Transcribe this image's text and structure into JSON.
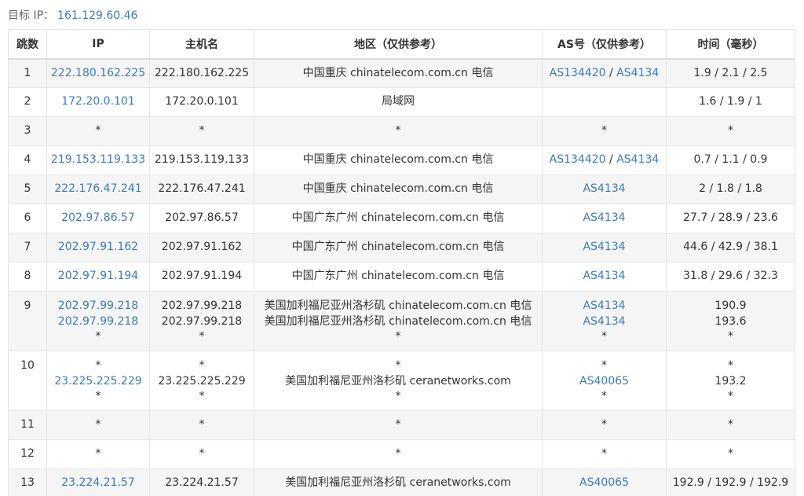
{
  "header": {
    "label": "目标 IP：",
    "ip": "161.129.60.46"
  },
  "columns": [
    "跳数",
    "IP",
    "主机名",
    "地区（仅供参考）",
    "AS号（仅供参考）",
    "时间（毫秒）"
  ],
  "rows": [
    {
      "hop": "1",
      "ip": [
        "222.180.162.225"
      ],
      "host": [
        "222.180.162.225"
      ],
      "region": [
        "中国重庆 chinatelecom.com.cn 电信"
      ],
      "as": [
        [
          "AS134420",
          "AS4134"
        ]
      ],
      "time": [
        "1.9 / 2.1 / 2.5"
      ]
    },
    {
      "hop": "2",
      "ip": [
        "172.20.0.101"
      ],
      "host": [
        "172.20.0.101"
      ],
      "region": [
        "局域网"
      ],
      "as": [
        []
      ],
      "time": [
        "1.6 / 1.9 / 1"
      ]
    },
    {
      "hop": "3",
      "ip": [
        "*"
      ],
      "host": [
        "*"
      ],
      "region": [
        "*"
      ],
      "as": [
        [
          "*"
        ]
      ],
      "time": [
        "*"
      ]
    },
    {
      "hop": "4",
      "ip": [
        "219.153.119.133"
      ],
      "host": [
        "219.153.119.133"
      ],
      "region": [
        "中国重庆 chinatelecom.com.cn 电信"
      ],
      "as": [
        [
          "AS134420",
          "AS4134"
        ]
      ],
      "time": [
        "0.7 / 1.1 / 0.9"
      ]
    },
    {
      "hop": "5",
      "ip": [
        "222.176.47.241"
      ],
      "host": [
        "222.176.47.241"
      ],
      "region": [
        "中国重庆 chinatelecom.com.cn 电信"
      ],
      "as": [
        [
          "AS4134"
        ]
      ],
      "time": [
        "2 / 1.8 / 1.8"
      ]
    },
    {
      "hop": "6",
      "ip": [
        "202.97.86.57"
      ],
      "host": [
        "202.97.86.57"
      ],
      "region": [
        "中国广东广州 chinatelecom.com.cn 电信"
      ],
      "as": [
        [
          "AS4134"
        ]
      ],
      "time": [
        "27.7 / 28.9 / 23.6"
      ]
    },
    {
      "hop": "7",
      "ip": [
        "202.97.91.162"
      ],
      "host": [
        "202.97.91.162"
      ],
      "region": [
        "中国广东广州 chinatelecom.com.cn 电信"
      ],
      "as": [
        [
          "AS4134"
        ]
      ],
      "time": [
        "44.6 / 42.9 / 38.1"
      ]
    },
    {
      "hop": "8",
      "ip": [
        "202.97.91.194"
      ],
      "host": [
        "202.97.91.194"
      ],
      "region": [
        "中国广东广州 chinatelecom.com.cn 电信"
      ],
      "as": [
        [
          "AS4134"
        ]
      ],
      "time": [
        "31.8 / 29.6 / 32.3"
      ]
    },
    {
      "hop": "9",
      "ip": [
        "202.97.99.218",
        "202.97.99.218",
        "*"
      ],
      "host": [
        "202.97.99.218",
        "202.97.99.218",
        "*"
      ],
      "region": [
        "美国加利福尼亚州洛杉矶 chinatelecom.com.cn 电信",
        "美国加利福尼亚州洛杉矶 chinatelecom.com.cn 电信",
        "*"
      ],
      "as": [
        [
          "AS4134"
        ],
        [
          "AS4134"
        ],
        [
          "*"
        ]
      ],
      "time": [
        "190.9",
        "193.6",
        "*"
      ]
    },
    {
      "hop": "10",
      "ip": [
        "*",
        "23.225.225.229",
        "*"
      ],
      "host": [
        "*",
        "23.225.225.229",
        "*"
      ],
      "region": [
        "*",
        "美国加利福尼亚州洛杉矶 ceranetworks.com",
        "*"
      ],
      "as": [
        [
          "*"
        ],
        [
          "AS40065"
        ],
        [
          "*"
        ]
      ],
      "time": [
        "*",
        "193.2",
        "*"
      ]
    },
    {
      "hop": "11",
      "ip": [
        "*"
      ],
      "host": [
        "*"
      ],
      "region": [
        "*"
      ],
      "as": [
        [
          "*"
        ]
      ],
      "time": [
        "*"
      ]
    },
    {
      "hop": "12",
      "ip": [
        "*"
      ],
      "host": [
        "*"
      ],
      "region": [
        "*"
      ],
      "as": [
        [
          "*"
        ]
      ],
      "time": [
        "*"
      ]
    },
    {
      "hop": "13",
      "ip": [
        "23.224.21.57"
      ],
      "host": [
        "23.224.21.57"
      ],
      "region": [
        "美国加利福尼亚州洛杉矶 ceranetworks.com"
      ],
      "as": [
        [
          "AS40065"
        ]
      ],
      "time": [
        "192.9 / 192.9 / 192.9"
      ]
    }
  ]
}
